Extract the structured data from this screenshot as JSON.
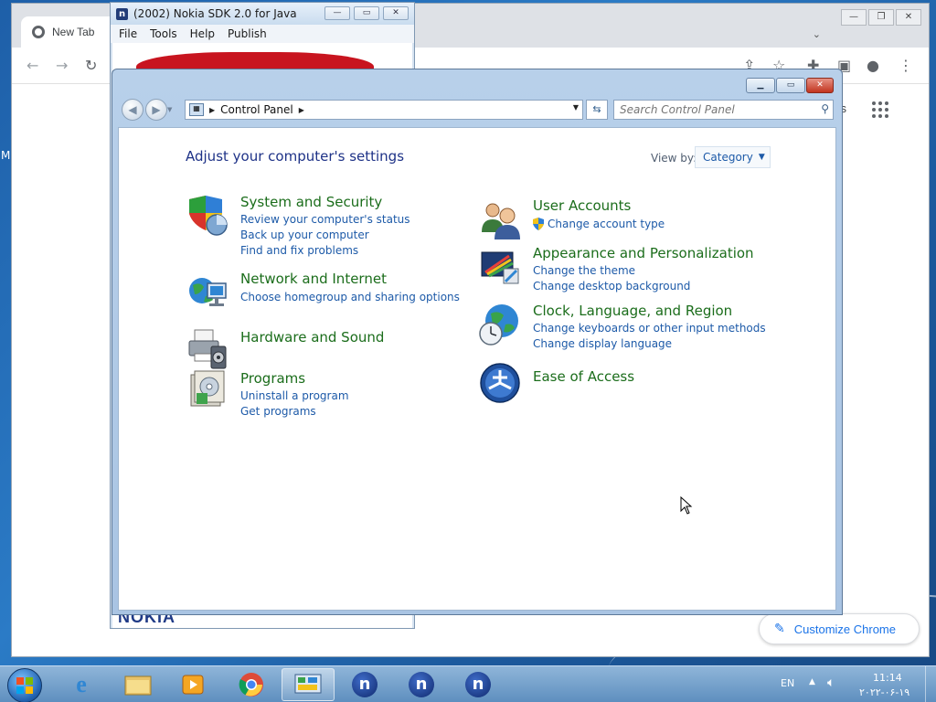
{
  "desktop": {
    "left_char": "M"
  },
  "chrome": {
    "tab_title": "New Tab",
    "partial_link": "ges",
    "customize_label": "Customize Chrome",
    "caption": [
      "—",
      "❐",
      "✕"
    ]
  },
  "nokia": {
    "title": "(2002) Nokia SDK 2.0 for Java",
    "logo_letter": "n",
    "menu": [
      "File",
      "Tools",
      "Help",
      "Publish"
    ],
    "brand": "NOKIA"
  },
  "control_panel": {
    "address_root": "Control Panel",
    "search_placeholder": "Search Control Panel",
    "heading": "Adjust your computer's settings",
    "view_by_label": "View by:",
    "view_by_value": "Category",
    "categories_left": [
      {
        "title": "System and Security",
        "links": [
          "Review your computer's status",
          "Back up your computer",
          "Find and fix problems"
        ]
      },
      {
        "title": "Network and Internet",
        "links": [
          "Choose homegroup and sharing options"
        ]
      },
      {
        "title": "Hardware and Sound",
        "links": []
      },
      {
        "title": "Programs",
        "links": [
          "Uninstall a program",
          "Get programs"
        ]
      }
    ],
    "categories_right": [
      {
        "title": "User Accounts",
        "links": [
          "Change account type"
        ]
      },
      {
        "title": "Appearance and Personalization",
        "links": [
          "Change the theme",
          "Change desktop background"
        ]
      },
      {
        "title": "Clock, Language, and Region",
        "links": [
          "Change keyboards or other input methods",
          "Change display language"
        ]
      },
      {
        "title": "Ease of Access",
        "links": []
      }
    ]
  },
  "taskbar": {
    "language": "EN",
    "time": "11:14",
    "date": "۲۰۲۲-۰۶-۱۹",
    "nokia_letter": "n"
  }
}
